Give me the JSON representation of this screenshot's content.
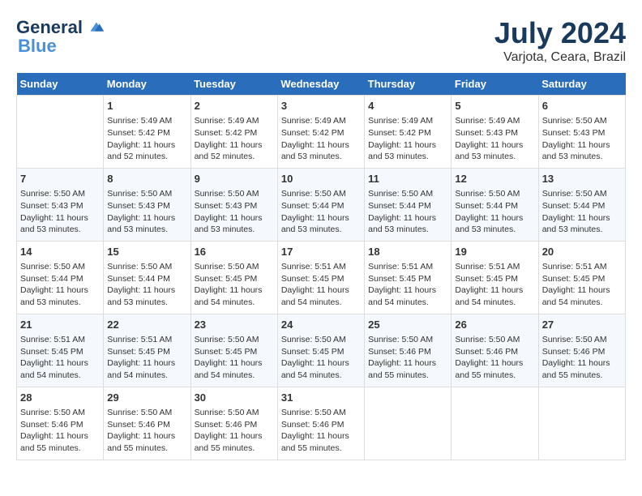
{
  "header": {
    "logo_line1": "General",
    "logo_line2": "Blue",
    "month_year": "July 2024",
    "location": "Varjota, Ceara, Brazil"
  },
  "days_of_week": [
    "Sunday",
    "Monday",
    "Tuesday",
    "Wednesday",
    "Thursday",
    "Friday",
    "Saturday"
  ],
  "weeks": [
    [
      {
        "day": "",
        "empty": true
      },
      {
        "day": "1",
        "sunrise": "5:49 AM",
        "sunset": "5:42 PM",
        "daylight": "11 hours and 52 minutes."
      },
      {
        "day": "2",
        "sunrise": "5:49 AM",
        "sunset": "5:42 PM",
        "daylight": "11 hours and 52 minutes."
      },
      {
        "day": "3",
        "sunrise": "5:49 AM",
        "sunset": "5:42 PM",
        "daylight": "11 hours and 53 minutes."
      },
      {
        "day": "4",
        "sunrise": "5:49 AM",
        "sunset": "5:42 PM",
        "daylight": "11 hours and 53 minutes."
      },
      {
        "day": "5",
        "sunrise": "5:49 AM",
        "sunset": "5:43 PM",
        "daylight": "11 hours and 53 minutes."
      },
      {
        "day": "6",
        "sunrise": "5:50 AM",
        "sunset": "5:43 PM",
        "daylight": "11 hours and 53 minutes."
      }
    ],
    [
      {
        "day": "7",
        "sunrise": "5:50 AM",
        "sunset": "5:43 PM",
        "daylight": "11 hours and 53 minutes."
      },
      {
        "day": "8",
        "sunrise": "5:50 AM",
        "sunset": "5:43 PM",
        "daylight": "11 hours and 53 minutes."
      },
      {
        "day": "9",
        "sunrise": "5:50 AM",
        "sunset": "5:43 PM",
        "daylight": "11 hours and 53 minutes."
      },
      {
        "day": "10",
        "sunrise": "5:50 AM",
        "sunset": "5:44 PM",
        "daylight": "11 hours and 53 minutes."
      },
      {
        "day": "11",
        "sunrise": "5:50 AM",
        "sunset": "5:44 PM",
        "daylight": "11 hours and 53 minutes."
      },
      {
        "day": "12",
        "sunrise": "5:50 AM",
        "sunset": "5:44 PM",
        "daylight": "11 hours and 53 minutes."
      },
      {
        "day": "13",
        "sunrise": "5:50 AM",
        "sunset": "5:44 PM",
        "daylight": "11 hours and 53 minutes."
      }
    ],
    [
      {
        "day": "14",
        "sunrise": "5:50 AM",
        "sunset": "5:44 PM",
        "daylight": "11 hours and 53 minutes."
      },
      {
        "day": "15",
        "sunrise": "5:50 AM",
        "sunset": "5:44 PM",
        "daylight": "11 hours and 53 minutes."
      },
      {
        "day": "16",
        "sunrise": "5:50 AM",
        "sunset": "5:45 PM",
        "daylight": "11 hours and 54 minutes."
      },
      {
        "day": "17",
        "sunrise": "5:51 AM",
        "sunset": "5:45 PM",
        "daylight": "11 hours and 54 minutes."
      },
      {
        "day": "18",
        "sunrise": "5:51 AM",
        "sunset": "5:45 PM",
        "daylight": "11 hours and 54 minutes."
      },
      {
        "day": "19",
        "sunrise": "5:51 AM",
        "sunset": "5:45 PM",
        "daylight": "11 hours and 54 minutes."
      },
      {
        "day": "20",
        "sunrise": "5:51 AM",
        "sunset": "5:45 PM",
        "daylight": "11 hours and 54 minutes."
      }
    ],
    [
      {
        "day": "21",
        "sunrise": "5:51 AM",
        "sunset": "5:45 PM",
        "daylight": "11 hours and 54 minutes."
      },
      {
        "day": "22",
        "sunrise": "5:51 AM",
        "sunset": "5:45 PM",
        "daylight": "11 hours and 54 minutes."
      },
      {
        "day": "23",
        "sunrise": "5:50 AM",
        "sunset": "5:45 PM",
        "daylight": "11 hours and 54 minutes."
      },
      {
        "day": "24",
        "sunrise": "5:50 AM",
        "sunset": "5:45 PM",
        "daylight": "11 hours and 54 minutes."
      },
      {
        "day": "25",
        "sunrise": "5:50 AM",
        "sunset": "5:46 PM",
        "daylight": "11 hours and 55 minutes."
      },
      {
        "day": "26",
        "sunrise": "5:50 AM",
        "sunset": "5:46 PM",
        "daylight": "11 hours and 55 minutes."
      },
      {
        "day": "27",
        "sunrise": "5:50 AM",
        "sunset": "5:46 PM",
        "daylight": "11 hours and 55 minutes."
      }
    ],
    [
      {
        "day": "28",
        "sunrise": "5:50 AM",
        "sunset": "5:46 PM",
        "daylight": "11 hours and 55 minutes."
      },
      {
        "day": "29",
        "sunrise": "5:50 AM",
        "sunset": "5:46 PM",
        "daylight": "11 hours and 55 minutes."
      },
      {
        "day": "30",
        "sunrise": "5:50 AM",
        "sunset": "5:46 PM",
        "daylight": "11 hours and 55 minutes."
      },
      {
        "day": "31",
        "sunrise": "5:50 AM",
        "sunset": "5:46 PM",
        "daylight": "11 hours and 55 minutes."
      },
      {
        "day": "",
        "empty": true
      },
      {
        "day": "",
        "empty": true
      },
      {
        "day": "",
        "empty": true
      }
    ]
  ]
}
